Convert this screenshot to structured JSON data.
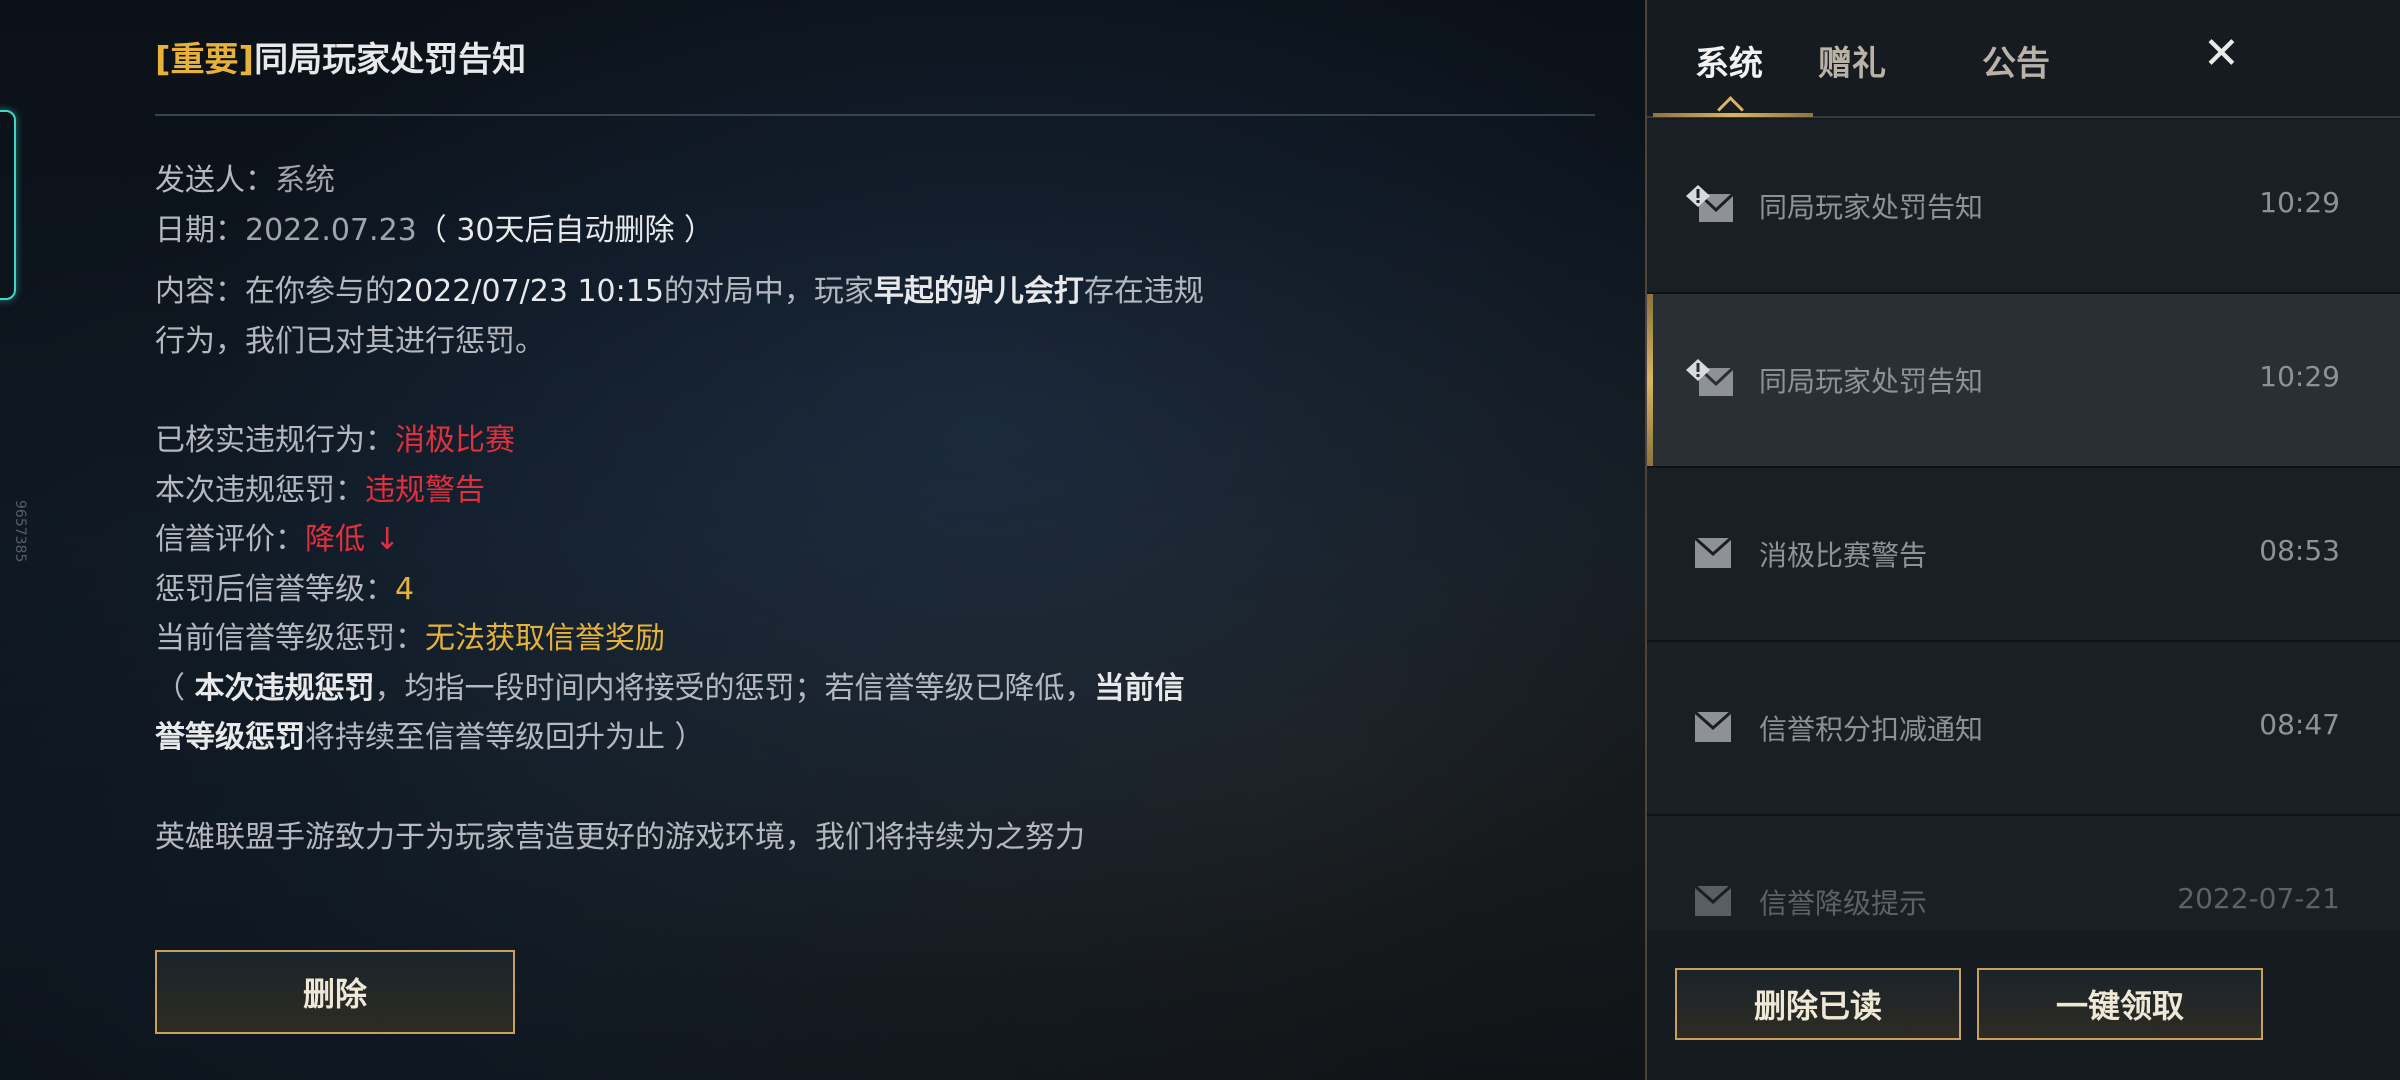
{
  "side": {
    "id_text": "9657385"
  },
  "detail": {
    "title_tag": "[重要]",
    "title": "同局玩家处罚告知",
    "sender_label": "发送人：",
    "sender_value": "系统",
    "date_label": "日期：",
    "date_value": "2022.07.23",
    "date_note": "（ 30天后自动删除 ）",
    "content_label": "内容：",
    "content_part1": "在你参与的",
    "content_datetime": "2022/07/23 10:15",
    "content_part2": "的对局中，玩家",
    "content_player": "早起的驴儿会打",
    "content_part3": "存在违规",
    "content_line2": "行为，我们已对其进行惩罚。",
    "verified_label": "已核实违规行为：",
    "verified_value": "消极比赛",
    "penalty_label": "本次违规惩罚：",
    "penalty_value": "违规警告",
    "credit_label": "信誉评价：",
    "credit_value": "降低 ↓",
    "level_label": "惩罚后信誉等级：",
    "level_value": "4",
    "current_label": "当前信誉等级惩罚：",
    "current_value": "无法获取信誉奖励",
    "note_open": "（ ",
    "note_bold1": "本次违规惩罚",
    "note_mid": "，均指一段时间内将接受的惩罚；若信誉等级已降低，",
    "note_bold2a": "当前信",
    "note_bold2b": "誉等级惩罚",
    "note_end": "将持续至信誉等级回升为止 ）",
    "footer": "英雄联盟手游致力于为玩家营造更好的游戏环境，我们将持续为之努力",
    "delete_label": "删除"
  },
  "panel": {
    "tabs": [
      "系统",
      "赠礼",
      "公告"
    ],
    "close_label": "✕",
    "messages": [
      {
        "name": "同局玩家处罚告知",
        "time": "10:29",
        "icon": "important-mail-icon"
      },
      {
        "name": "同局玩家处罚告知",
        "time": "10:29",
        "icon": "important-mail-icon"
      },
      {
        "name": "消极比赛警告",
        "time": "08:53",
        "icon": "mail-icon"
      },
      {
        "name": "信誉积分扣减通知",
        "time": "08:47",
        "icon": "mail-icon"
      },
      {
        "name": "信誉降级提示",
        "time": "2022-07-21",
        "icon": "mail-icon"
      }
    ],
    "delete_read_label": "删除已读",
    "claim_all_label": "一键领取"
  }
}
